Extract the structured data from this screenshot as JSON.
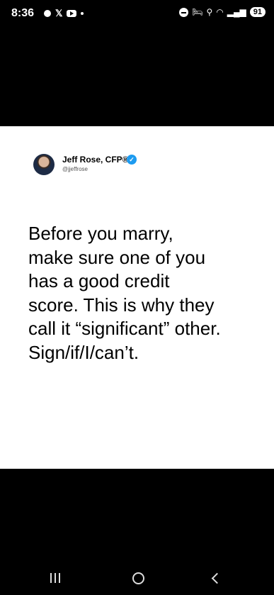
{
  "status_bar": {
    "time": "8:36",
    "battery": "91",
    "icons": [
      "notification-dot-icon",
      "x-app-icon",
      "youtube-icon",
      "more-dot-icon",
      "dnd-icon",
      "bed-icon",
      "location-icon",
      "wifi-icon",
      "signal-icon",
      "battery-icon"
    ]
  },
  "tweet": {
    "author_name": "Jeff Rose, CFP®",
    "handle": "@jjeffrose",
    "lines": [
      "Before you marry,",
      "make sure one of you",
      "has a good credit",
      "score. This is why they",
      "call it “significant” other.",
      "Sign/if/I/can’t."
    ]
  },
  "colors": {
    "verified": "#1d9bf0",
    "background": "#000000",
    "card": "#ffffff"
  }
}
